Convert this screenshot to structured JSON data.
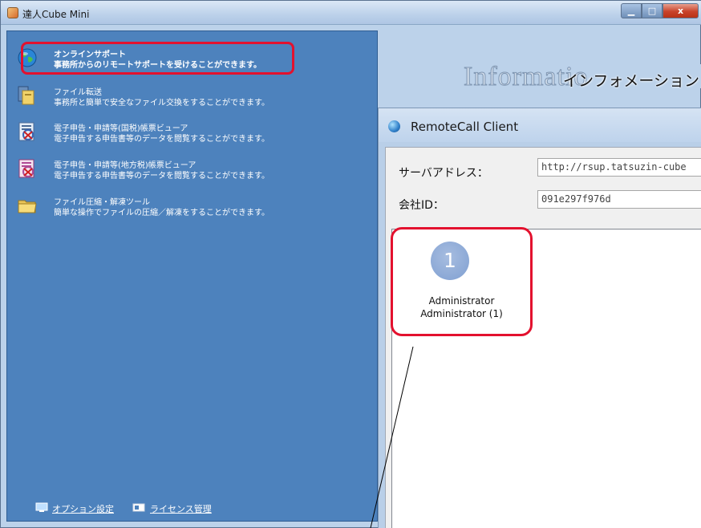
{
  "window": {
    "title": "達人Cube Mini",
    "controls": {
      "minimize": "▁",
      "maximize": "□",
      "close": "x"
    }
  },
  "menu": {
    "items": [
      {
        "title": "オンラインサポート",
        "desc": "事務所からのリモートサポートを受けることができます。",
        "icon": "globe-icon"
      },
      {
        "title": "ファイル転送",
        "desc": "事務所と簡単で安全なファイル交換をすることができます。",
        "icon": "file-transfer-icon"
      },
      {
        "title": "電子申告・申請等(国税)帳票ビューア",
        "desc": "電子申告する申告書等のデータを閲覧することができます。",
        "icon": "national-tax-viewer-icon"
      },
      {
        "title": "電子申告・申請等(地方税)帳票ビューア",
        "desc": "電子申告する申告書等のデータを閲覧することができます。",
        "icon": "local-tax-viewer-icon"
      },
      {
        "title": "ファイル圧縮・解凍ツール",
        "desc": "簡単な操作でファイルの圧縮／解凍をすることができます。",
        "icon": "folder-icon"
      }
    ]
  },
  "footer": {
    "options_label": "オプション設定",
    "license_label": "ライセンス管理"
  },
  "info_banner": {
    "big_text": "Informatio",
    "jp_text": "インフォメーション"
  },
  "remote_call": {
    "title": "RemoteCall Client",
    "server_label": "サーバアドレス：",
    "server_value": "http://rsup.tatsuzin-cube",
    "company_label": "会社ID：",
    "company_value": "091e297f976d",
    "user": {
      "number": "1",
      "name_line1": "Administrator",
      "name_line2": "Administrator (1)"
    }
  },
  "colors": {
    "panel_blue": "#4d82bd",
    "highlight_red": "#e3112e"
  }
}
